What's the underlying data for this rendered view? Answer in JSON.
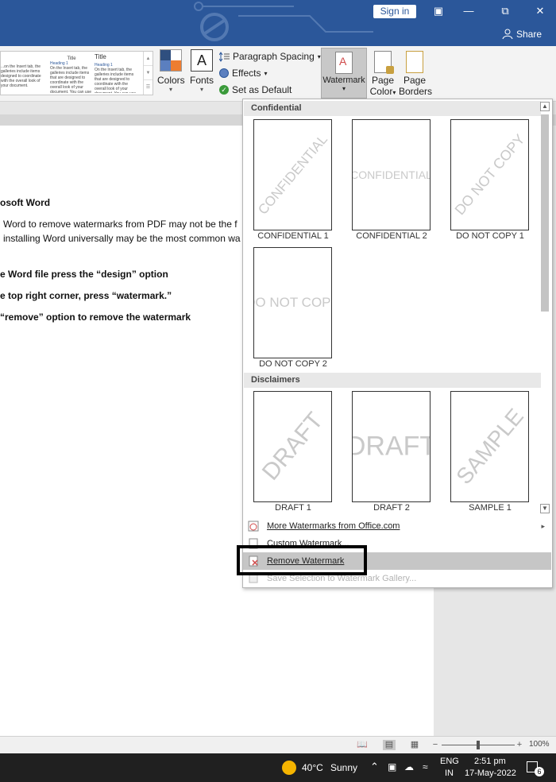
{
  "titlebar": {
    "signin": "Sign in",
    "share": "Share"
  },
  "ribbon": {
    "gallery": [
      {
        "title": "",
        "heading": "",
        "body": "...on the Insert tab, the galleries include items designed to coordinate with the overall look of your document."
      },
      {
        "title": "Title",
        "heading": "Heading 1",
        "body": "On the Insert tab, the galleries include items that are designed to coordinate with the overall look of your document. You can use these galleries to insert tables, headers, footers, lists."
      },
      {
        "title": "Title",
        "heading": "Heading 1",
        "body": "On the Insert tab, the galleries include items that are designed to coordinate with the overall look of your document. You can use these galleries to insert..."
      }
    ],
    "colors": "Colors",
    "fonts": "Fonts",
    "fonts_glyph": "A",
    "paragraph_spacing": "Paragraph Spacing",
    "effects": "Effects",
    "set_default": "Set as Default",
    "watermark": "Watermark",
    "page_color": "Page Color",
    "page_color_l1": "Page",
    "page_color_l2": "Color",
    "page_borders_l1": "Page",
    "page_borders_l2": "Borders"
  },
  "document": {
    "lines": [
      "osoft Word",
      "Word to remove watermarks from PDF may not be the f",
      "installing Word universally may be the most common wa",
      "e Word file press the “design” option",
      "e top right corner, press “watermark.”",
      "“remove” option to remove the watermark"
    ]
  },
  "watermark_menu": {
    "sections": [
      {
        "header": "Confidential",
        "items": [
          {
            "label": "CONFIDENTIAL 1",
            "text": "CONFIDENTIAL"
          },
          {
            "label": "CONFIDENTIAL 2",
            "text": "CONFIDENTIAL"
          },
          {
            "label": "DO NOT COPY 1",
            "text": "DO NOT COPY"
          },
          {
            "label": "DO NOT COPY 2",
            "text": "DO NOT COPY"
          }
        ]
      },
      {
        "header": "Disclaimers",
        "items": [
          {
            "label": "DRAFT 1",
            "text": "DRAFT"
          },
          {
            "label": "DRAFT 2",
            "text": "DRAFT"
          },
          {
            "label": "SAMPLE 1",
            "text": "SAMPLE"
          }
        ]
      }
    ],
    "actions": [
      {
        "label": "More Watermarks from Office.com",
        "enabled": true
      },
      {
        "label": "Custom Watermark...",
        "enabled": true
      },
      {
        "label": "Remove Watermark",
        "enabled": true
      },
      {
        "label": "Save Selection to Watermark Gallery...",
        "enabled": false
      }
    ]
  },
  "statusbar": {
    "zoom": "100%",
    "minus": "−",
    "plus": "+"
  },
  "taskbar": {
    "temperature": "40°C",
    "weather": "Sunny",
    "lang1": "ENG",
    "lang2": "IN",
    "time": "2:51 pm",
    "date": "17-May-2022",
    "notifications": "6"
  },
  "colors": {
    "title_bar": "#2b579a",
    "highlight": "#000000"
  }
}
